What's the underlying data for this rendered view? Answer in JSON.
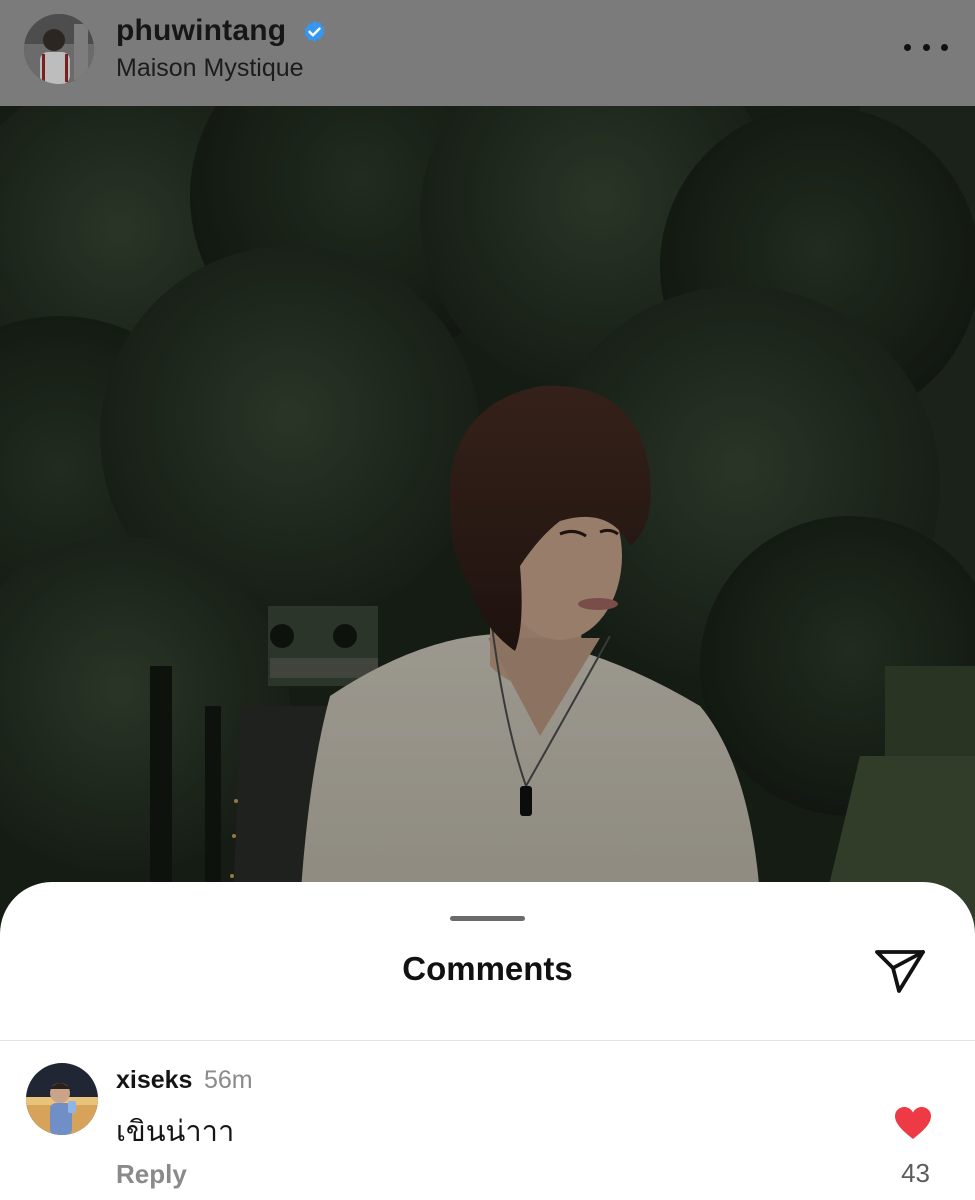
{
  "post": {
    "username": "phuwintang",
    "location": "Maison Mystique",
    "verified": true
  },
  "comments_sheet": {
    "title": "Comments",
    "comments": [
      {
        "username": "xiseks",
        "time": "56m",
        "text": "เขินน่าาา",
        "reply_label": "Reply",
        "likes": "43",
        "liked": true
      }
    ]
  },
  "icons": {
    "verified": "verified-badge-icon",
    "more": "more-options-icon",
    "share": "paper-plane-icon",
    "like": "heart-icon"
  },
  "colors": {
    "verified_blue": "#3797f0",
    "like_red": "#ed3a45",
    "header_gray": "#7b7b7b"
  }
}
